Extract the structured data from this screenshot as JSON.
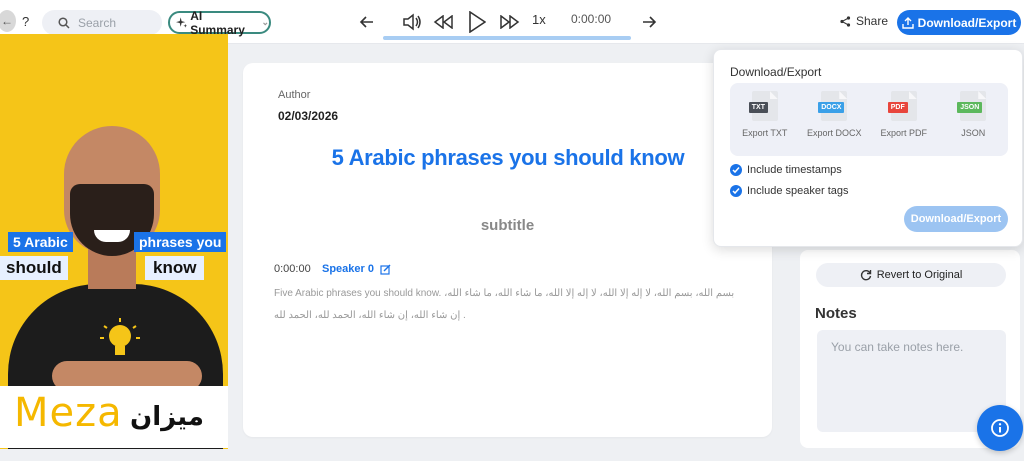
{
  "header": {
    "back_glyph": "←",
    "help_glyph": "?",
    "search": {
      "placeholder": "Search"
    },
    "ai_summary_label": "AI Summary",
    "share_label": "Share",
    "download_label": "Download/Export"
  },
  "player": {
    "speed": "1x",
    "current_time": "0:00:00",
    "progress": 1.0
  },
  "video": {
    "captions": [
      "5 Arabic",
      "phrases you",
      "should",
      "know"
    ],
    "logo_text": "Meza",
    "logo_arabic": "ميزان"
  },
  "transcript": {
    "author_label": "Author",
    "date": "02/03/2026",
    "title": "5 Arabic phrases you should know",
    "subtitle": "subtitle",
    "segments": [
      {
        "time": "0:00:00",
        "speaker": "Speaker 0",
        "text": "Five Arabic phrases you should know. بسم الله، بسم الله، لا إله إلا الله، لا إله إلا الله، ما شاء الله، ما شاء الله، إن شاء الله، إن شاء الله، الحمد لله، الحمد لله ."
      }
    ]
  },
  "export_popup": {
    "title": "Download/Export",
    "formats": [
      {
        "tag": "TXT",
        "label": "Export TXT",
        "color": "#4a4f57"
      },
      {
        "tag": "DOCX",
        "label": "Export DOCX",
        "color": "#3aa0e8"
      },
      {
        "tag": "PDF",
        "label": "Export PDF",
        "color": "#e8453c"
      },
      {
        "tag": "JSON",
        "label": "JSON",
        "color": "#5cb85c"
      }
    ],
    "include_timestamps": "Include timestamps",
    "include_speaker_tags": "Include speaker tags",
    "download_label": "Download/Export"
  },
  "side": {
    "revert_label": "Revert to Original",
    "notes_title": "Notes",
    "notes_placeholder": "You can take notes here."
  },
  "colors": {
    "accent": "#1a73e8",
    "video_bg": "#f5c518"
  }
}
